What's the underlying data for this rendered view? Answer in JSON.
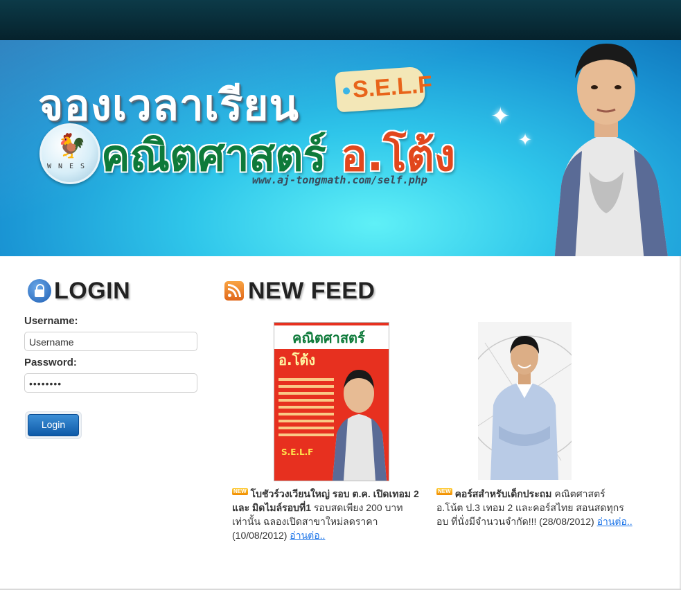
{
  "banner": {
    "title_line1": "จองเวลาเรียน",
    "tag_text": "S.E.L.F",
    "title_line2_green": "คณิตศาสตร์ ",
    "title_line2_red": "อ.โต้ง",
    "url": "www.aj-tongmath.com/self.php"
  },
  "login": {
    "heading": "LOGIN",
    "username_label": "Username:",
    "username_value": "Username",
    "password_label": "Password:",
    "password_value": "••••••••",
    "button_label": "Login"
  },
  "feed": {
    "heading": "NEW FEED",
    "items": [
      {
        "badge": "NEW",
        "title": "โบชัวร์วงเวียนใหญ่ รอบ ต.ค. เปิดเทอม 2 และ มิดไมล์รอบที่1",
        "desc": " รอบสดเพียง 200 บาทเท่านั้น ฉลองเปิดสาขาใหม่ลดราคา (10/08/2012) ",
        "more": "อ่านต่อ..",
        "cover_title": "คณิตศาสตร์",
        "cover_sub": "อ.โต้ง",
        "cover_self": "S.E.L.F"
      },
      {
        "badge": "NEW",
        "title": "คอร์สสำหรับเด็กประถม",
        "desc": " คณิตศาสตร์ อ.โน้ต ป.3 เทอม 2 และคอร์สไทย สอนสดทุกรอบ ที่นั่งมีจำนวนจำกัด!!! (28/08/2012) ",
        "more": "อ่านต่อ.."
      }
    ]
  },
  "colors": {
    "banner_blue": "#1a95d4",
    "title_green": "#0e7a3a",
    "title_red": "#e2471c",
    "button_blue": "#0e5aa8",
    "link_blue": "#1a73e8"
  }
}
